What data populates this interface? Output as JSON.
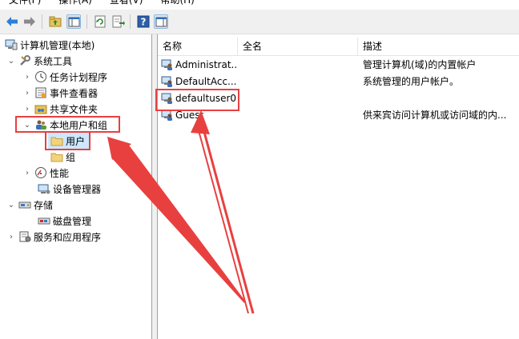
{
  "menu": {
    "items": [
      "文件(F)",
      "操作(A)",
      "查看(V)",
      "帮助(H)"
    ]
  },
  "toolbar": {
    "buttons": [
      "back-arrow-icon",
      "forward-arrow-icon",
      "up-folder-icon",
      "show-hide-tree-icon",
      "refresh-icon",
      "export-list-icon",
      "help-icon",
      "action-pane-icon"
    ]
  },
  "tree": {
    "root": "计算机管理(本地)",
    "system_tools": "系统工具",
    "task_scheduler": "任务计划程序",
    "event_viewer": "事件查看器",
    "shared_folders": "共享文件夹",
    "local_users_groups": "本地用户和组",
    "users": "用户",
    "groups": "组",
    "performance": "性能",
    "device_manager": "设备管理器",
    "storage": "存储",
    "disk_management": "磁盘管理",
    "services_apps": "服务和应用程序"
  },
  "list": {
    "columns": [
      "名称",
      "全名",
      "描述"
    ],
    "rows": [
      {
        "name": "Administrat...",
        "fullname": "",
        "desc": "管理计算机(域)的内置帐户"
      },
      {
        "name": "DefaultAcc...",
        "fullname": "",
        "desc": "系统管理的用户帐户。"
      },
      {
        "name": "defaultuser0",
        "fullname": "",
        "desc": ""
      },
      {
        "name": "Guest",
        "fullname": "",
        "desc": "供来宾访问计算机或访问域的内..."
      }
    ]
  },
  "colors": {
    "annotation_red": "#e8403f",
    "selection_blue": "#cce8ff"
  }
}
